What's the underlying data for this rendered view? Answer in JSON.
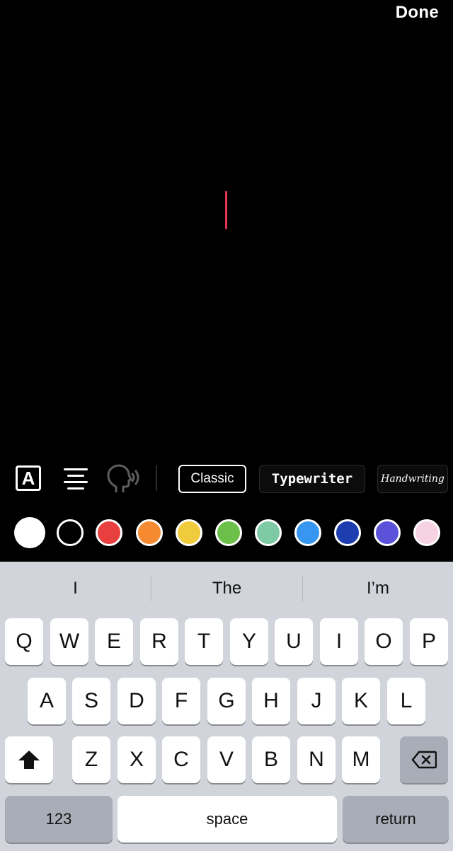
{
  "header": {
    "done_label": "Done"
  },
  "toolbar": {
    "text_style_icon_label": "A",
    "fonts": [
      "Classic",
      "Typewriter",
      "Handwriting"
    ]
  },
  "palette": {
    "colors": [
      "#ffffff",
      "#000000",
      "#e8403f",
      "#f58a30",
      "#f0cb3c",
      "#6cc04a",
      "#7dcaa5",
      "#3796f0",
      "#1e3eb0",
      "#5a52d9",
      "#f7d2e2"
    ],
    "selected_index": 0
  },
  "keyboard": {
    "suggestions": [
      "I",
      "The",
      "I’m"
    ],
    "row1": [
      "Q",
      "W",
      "E",
      "R",
      "T",
      "Y",
      "U",
      "I",
      "O",
      "P"
    ],
    "row2": [
      "A",
      "S",
      "D",
      "F",
      "G",
      "H",
      "J",
      "K",
      "L"
    ],
    "row3": [
      "Z",
      "X",
      "C",
      "V",
      "B",
      "N",
      "M"
    ],
    "numbers_label": "123",
    "space_label": "space",
    "return_label": "return"
  }
}
